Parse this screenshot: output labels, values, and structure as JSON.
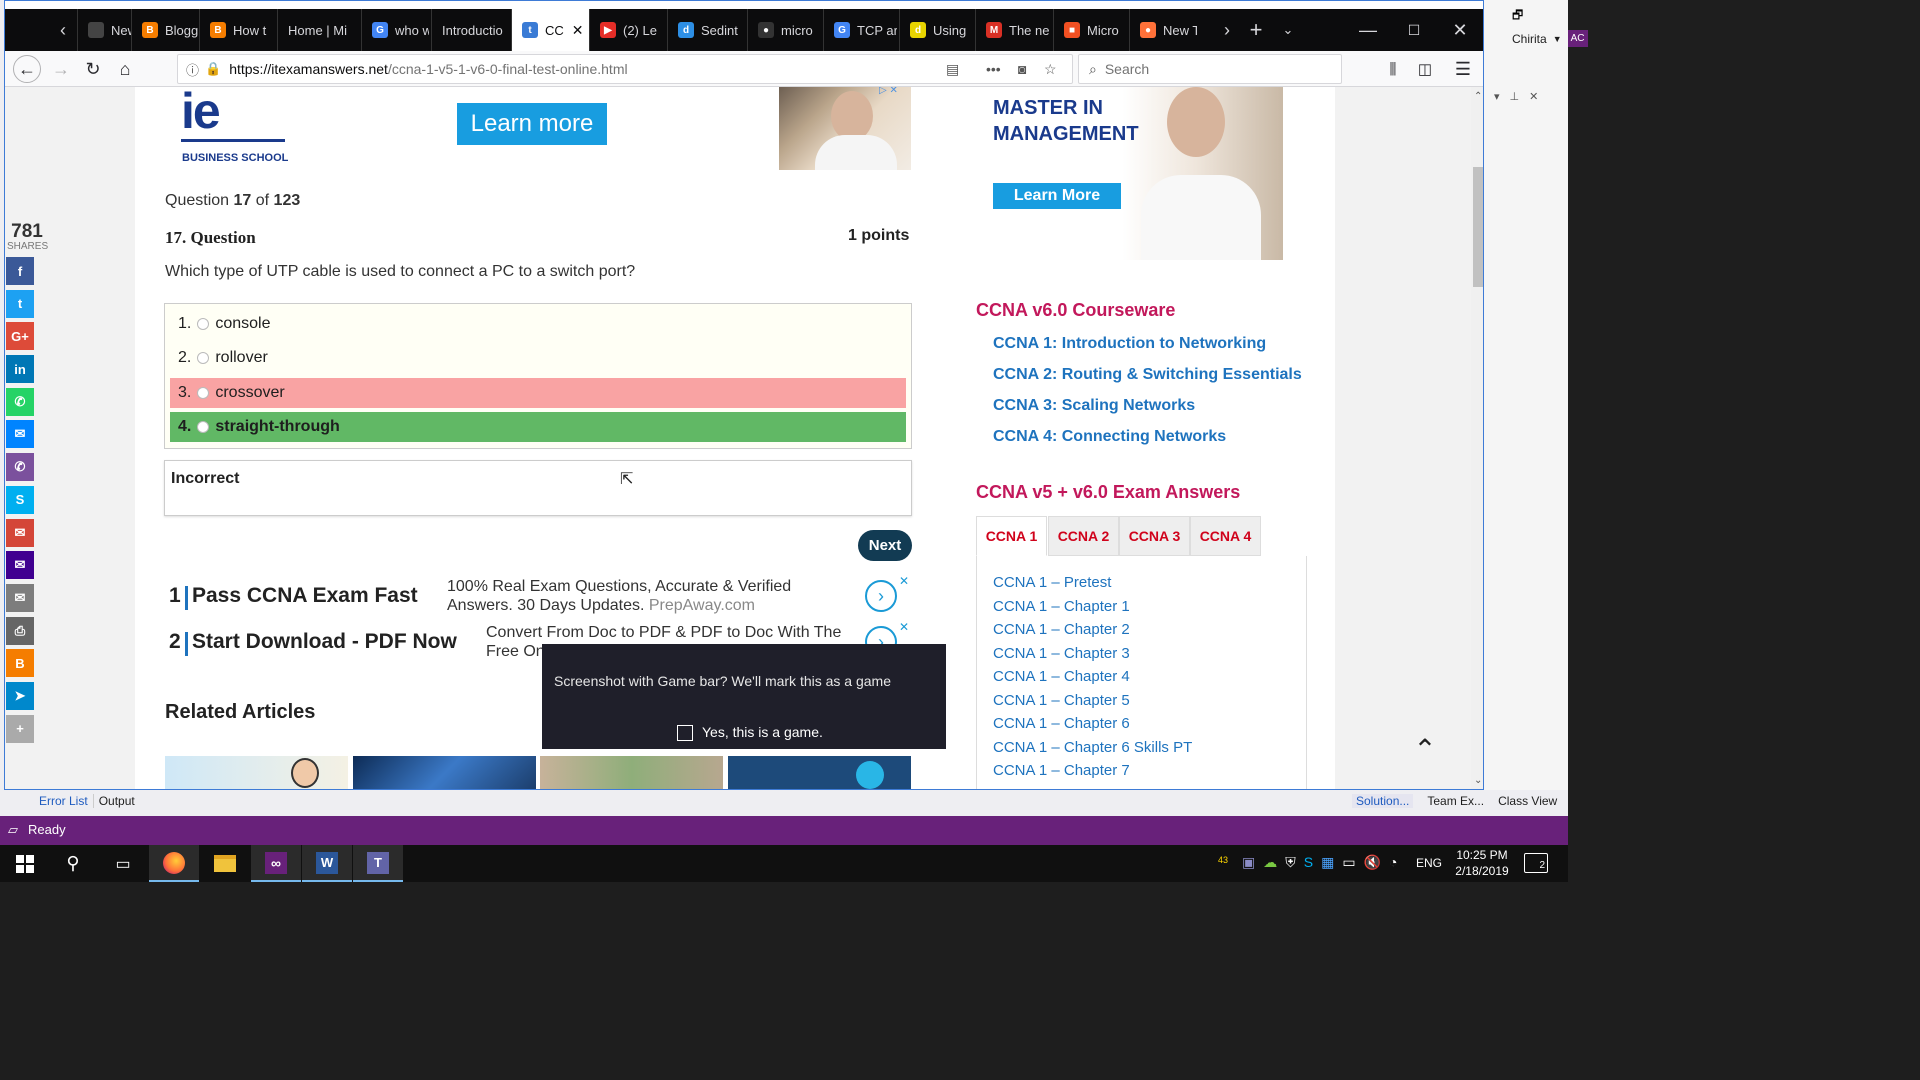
{
  "browser": {
    "tabs": [
      {
        "label": "New T",
        "color": "#444",
        "glyph": ""
      },
      {
        "label": "Blogg",
        "color": "#f57d00",
        "glyph": "B"
      },
      {
        "label": "How t",
        "color": "#f57d00",
        "glyph": "B"
      },
      {
        "label": "Home | Mi",
        "color": "",
        "glyph": ""
      },
      {
        "label": "who w",
        "color": "#4285f4",
        "glyph": "G"
      },
      {
        "label": "Introductio",
        "color": "",
        "glyph": ""
      },
      {
        "label": "CC",
        "color": "#3a7bd5",
        "glyph": "t"
      },
      {
        "label": "(2) Le",
        "color": "#e52d27",
        "glyph": "▶"
      },
      {
        "label": "Sedint",
        "color": "#2d8fe5",
        "glyph": "d"
      },
      {
        "label": "micro",
        "color": "#333",
        "glyph": "●"
      },
      {
        "label": "TCP ar",
        "color": "#4285f4",
        "glyph": "G"
      },
      {
        "label": "Using",
        "color": "#e8d400",
        "glyph": "d"
      },
      {
        "label": "The ne",
        "color": "#d93025",
        "glyph": "M"
      },
      {
        "label": "Micro",
        "color": "#f25022",
        "glyph": "■"
      },
      {
        "label": "New T",
        "color": "#ff7139",
        "glyph": "●"
      }
    ],
    "url_domain": "https://itexamanswers.net",
    "url_path": "/ccna-1-v5-1-v6-0-final-test-online.html",
    "search_placeholder": "Search"
  },
  "share": {
    "count": "781",
    "label": "SHARES",
    "buttons": [
      {
        "name": "facebook",
        "color": "#3b5998",
        "glyph": "f"
      },
      {
        "name": "twitter",
        "color": "#1da1f2",
        "glyph": "t"
      },
      {
        "name": "google-plus",
        "color": "#dd4b39",
        "glyph": "G+"
      },
      {
        "name": "linkedin",
        "color": "#0077b5",
        "glyph": "in"
      },
      {
        "name": "whatsapp",
        "color": "#25d366",
        "glyph": "✆"
      },
      {
        "name": "messenger",
        "color": "#0084ff",
        "glyph": "✉"
      },
      {
        "name": "viber",
        "color": "#7b519d",
        "glyph": "✆"
      },
      {
        "name": "skype",
        "color": "#00aff0",
        "glyph": "S"
      },
      {
        "name": "gmail",
        "color": "#d44638",
        "glyph": "✉"
      },
      {
        "name": "yahoo-mail",
        "color": "#400090",
        "glyph": "✉"
      },
      {
        "name": "email",
        "color": "#7d7d7d",
        "glyph": "✉"
      },
      {
        "name": "print",
        "color": "#666",
        "glyph": "⎙"
      },
      {
        "name": "blogger",
        "color": "#f57d00",
        "glyph": "B"
      },
      {
        "name": "telegram",
        "color": "#0088cc",
        "glyph": "➤"
      },
      {
        "name": "more",
        "color": "#aaa",
        "glyph": "+"
      }
    ]
  },
  "ad_top": {
    "brand": "ie",
    "brand_sub": "BUSINESS SCHOOL",
    "button": "Learn more"
  },
  "ad_side": {
    "headline_1": "MASTER IN",
    "headline_2": "MANAGEMENT",
    "button": "Learn More"
  },
  "question": {
    "counter_prefix": "Question",
    "counter_current": "17",
    "counter_of": "of",
    "counter_total": "123",
    "title": "17. Question",
    "points": "1 points",
    "text": "Which type of UTP cable is used to connect a PC to a switch port?",
    "options": [
      {
        "num": "1.",
        "text": "console"
      },
      {
        "num": "2.",
        "text": "rollover"
      },
      {
        "num": "3.",
        "text": "crossover"
      },
      {
        "num": "4.",
        "text": "straight-through"
      }
    ],
    "wrong_color": "#f9a3a3",
    "right_color": "#61b865",
    "result": "Incorrect",
    "next": "Next"
  },
  "ads_text": [
    {
      "num": "1",
      "title": "Pass CCNA Exam Fast",
      "desc_1": "100% Real Exam Questions, Accurate & Verified",
      "desc_2": "Answers. 30 Days Updates.",
      "source": "PrepAway.com"
    },
    {
      "num": "2",
      "title": "Start Download - PDF Now",
      "desc_1": "Convert From Doc to PDF & PDF to Doc With The",
      "desc_2": "Free On",
      "source": ""
    }
  ],
  "related": {
    "heading": "Related Articles"
  },
  "sidebar": {
    "courseware_heading": "CCNA v6.0 Courseware",
    "courseware_links": [
      "CCNA 1: Introduction to Networking",
      "CCNA 2: Routing & Switching Essentials",
      "CCNA 3: Scaling Networks",
      "CCNA 4: Connecting Networks"
    ],
    "exam_heading": "CCNA v5 + v6.0 Exam Answers",
    "exam_tabs": [
      "CCNA 1",
      "CCNA 2",
      "CCNA 3",
      "CCNA 4"
    ],
    "chapters": [
      "CCNA 1 – Pretest",
      "CCNA 1 – Chapter 1",
      "CCNA 1 – Chapter 2",
      "CCNA 1 – Chapter 3",
      "CCNA 1 – Chapter 4",
      "CCNA 1 – Chapter 5",
      "CCNA 1 – Chapter 6",
      "CCNA 1 – Chapter 6 Skills PT",
      "CCNA 1 – Chapter 7"
    ]
  },
  "gamebar": {
    "message": "Screenshot with Game bar? We'll mark this as a game",
    "checkbox": "Yes, this is a game."
  },
  "vs": {
    "user_name": "Chirita",
    "user_initials": "AC",
    "bottom_tabs_left": [
      "Error List",
      "Output"
    ],
    "bottom_tabs_right": [
      "Solution...",
      "Team Ex...",
      "Class View"
    ],
    "status": "Ready"
  },
  "taskbar": {
    "tray_badge": "43",
    "language": "ENG",
    "time": "10:25 PM",
    "date": "2/18/2019",
    "notif_count": "2"
  }
}
